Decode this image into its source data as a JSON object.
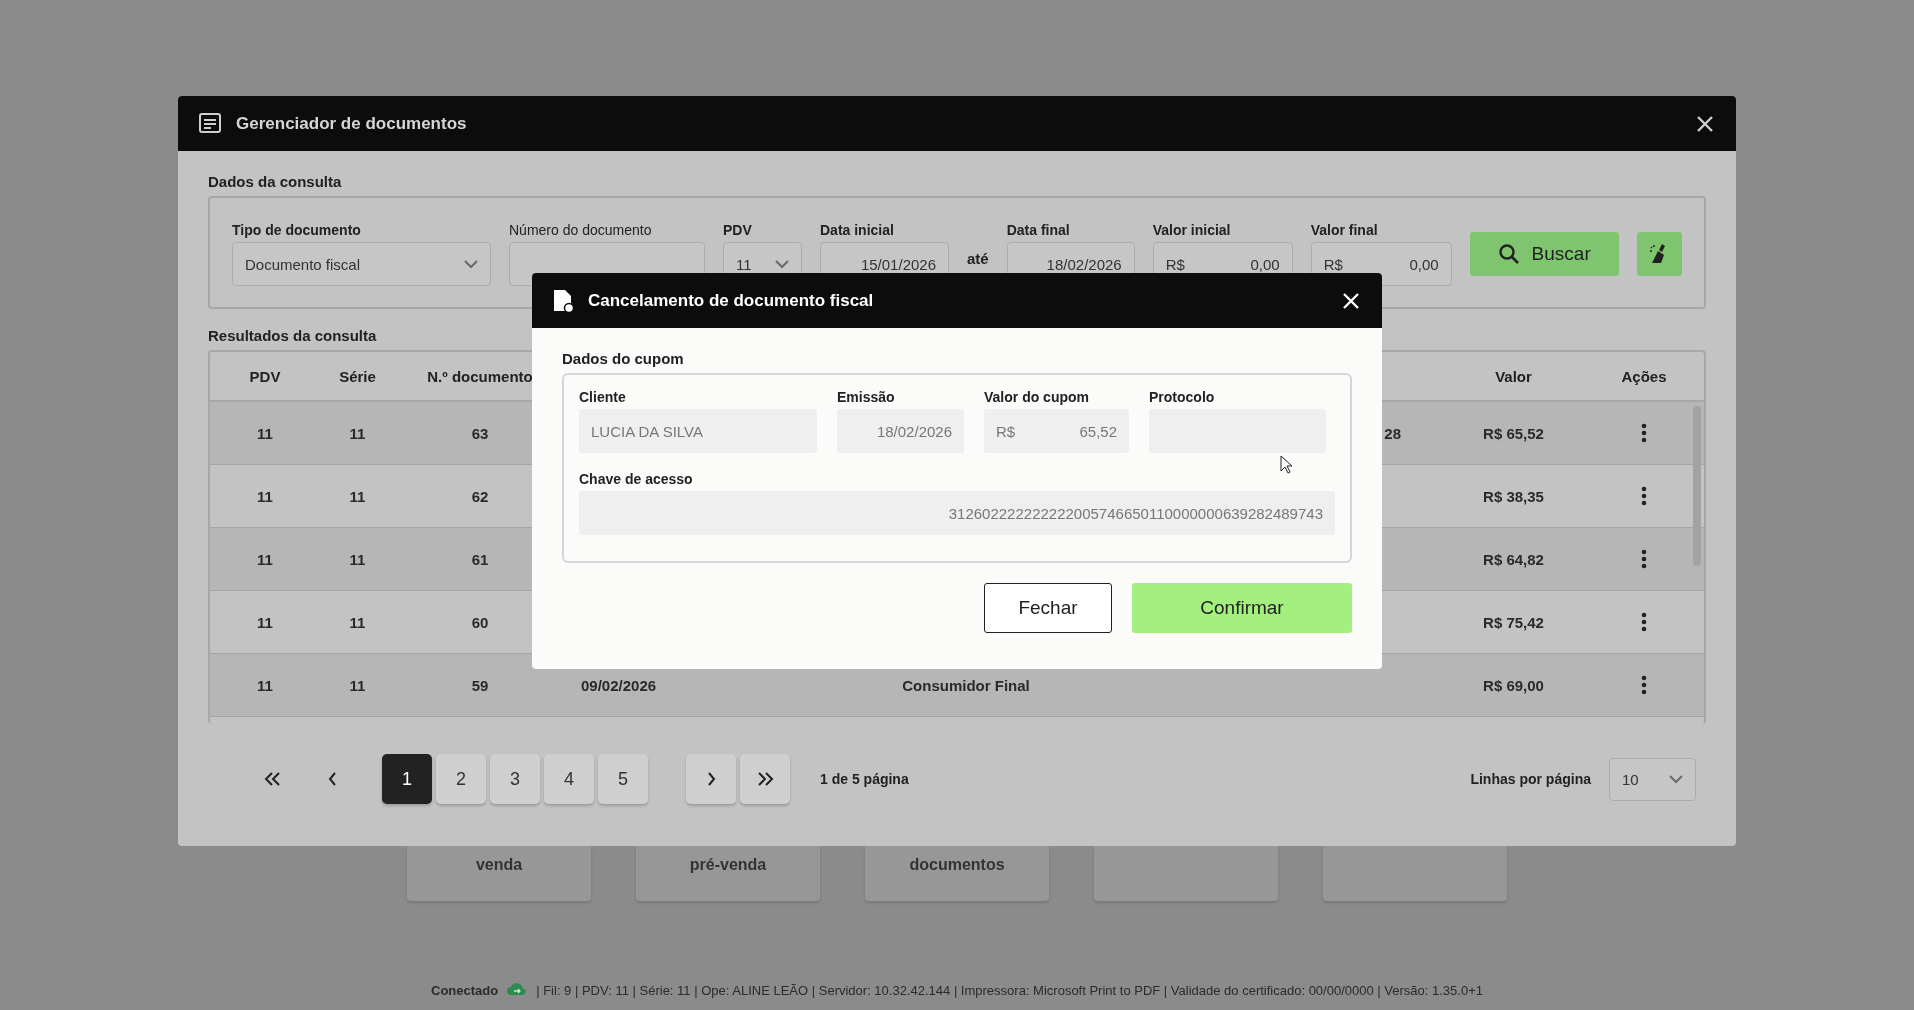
{
  "background_tiles": [
    {
      "kind": "tile",
      "label": "venda"
    },
    {
      "kind": "tile",
      "label": "pré-venda"
    },
    {
      "kind": "tile",
      "label": "documentos"
    },
    {
      "kind": "tile"
    },
    {
      "kind": "tile"
    }
  ],
  "status_bar": {
    "connection": "Conectado",
    "details": "| Fil: 9 | PDV: 11 | Série: 11 | Ope: ALINE LEÃO | Servidor: 10.32.42.144 | Impressora: Microsoft Print to PDF | Validade do certificado: 00/00/0000 | Versão: 1.35.0+1"
  },
  "window": {
    "title": "Gerenciador de documentos",
    "query_section": {
      "title": "Dados da consulta",
      "filters": [
        {
          "kind": "select",
          "label": "Tipo de documento",
          "emphasized": true,
          "value": "Documento fiscal"
        },
        {
          "kind": "text",
          "label": "Número do documento",
          "emphasized": false
        },
        {
          "kind": "select",
          "label": "PDV",
          "emphasized": true,
          "value": "11"
        },
        {
          "kind": "date",
          "label": "Data inicial",
          "emphasized": true,
          "value": "15/01/2026"
        },
        {
          "kind": "separator",
          "text": "até"
        },
        {
          "kind": "date",
          "label": "Data final",
          "emphasized": true,
          "value": "18/02/2026"
        },
        {
          "kind": "currency",
          "label": "Valor inicial",
          "emphasized": true,
          "prefix": "R$",
          "value": "0,00"
        },
        {
          "kind": "currency",
          "label": "Valor final",
          "emphasized": true,
          "prefix": "R$",
          "value": "0,00"
        }
      ],
      "search_button": "Buscar"
    },
    "results_section": {
      "title": "Resultados da consulta",
      "columns": [
        "PDV",
        "Série",
        "N.º documento",
        "Valor",
        "Ações"
      ],
      "rows": [
        {
          "pdv": "11",
          "serie": "11",
          "numero": "63",
          "column_6": "28",
          "valor": "R$ 65,52"
        },
        {
          "pdv": "11",
          "serie": "11",
          "numero": "62",
          "valor": "R$ 38,35"
        },
        {
          "pdv": "11",
          "serie": "11",
          "numero": "61",
          "valor": "R$ 64,82"
        },
        {
          "pdv": "11",
          "serie": "11",
          "numero": "60",
          "valor": "R$ 75,42"
        },
        {
          "pdv": "11",
          "serie": "11",
          "numero": "59",
          "data": "09/02/2026",
          "cliente": "Consumidor Final",
          "valor": "R$ 69,00"
        }
      ]
    },
    "pagination": {
      "pages": [
        {
          "label": "1",
          "selected": true
        },
        {
          "label": "2",
          "selected": false
        },
        {
          "label": "3",
          "selected": false
        },
        {
          "label": "4",
          "selected": false
        },
        {
          "label": "5",
          "selected": false
        }
      ],
      "summary": "1 de 5 página",
      "rows_per_page_label": "Linhas por página",
      "rows_per_page": "10"
    }
  },
  "dialog": {
    "title": "Cancelamento de documento fiscal",
    "section_title": "Dados do cupom",
    "fields": [
      {
        "label": "Cliente",
        "value": "LUCIA DA SILVA"
      },
      {
        "label": "Emissão",
        "value": "18/02/2026"
      },
      {
        "label": "Valor do cupom",
        "prefix": "R$",
        "value": "65,52"
      },
      {
        "label": "Protocolo"
      }
    ],
    "access_key": {
      "label": "Chave de acesso",
      "value": "312602222222222005746650110000000639282489743"
    },
    "buttons": [
      {
        "kind": "secondary",
        "label": "Fechar"
      },
      {
        "kind": "primary",
        "label": "Confirmar"
      }
    ]
  }
}
